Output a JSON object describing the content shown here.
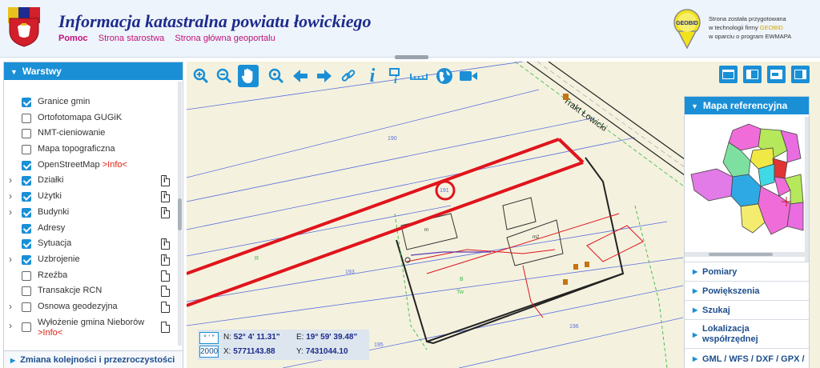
{
  "header": {
    "title": "Informacja katastralna powiatu łowickiego",
    "links": [
      "Pomoc",
      "Strona starostwa",
      "Strona główna geoportalu"
    ],
    "geobid_lines": [
      "Strona została przygotowana",
      "w technologii firmy ",
      "w oparciu o program EWMAPA"
    ],
    "geobid_brand": "GEOBID",
    "geobid_logo_text": "GEOBID"
  },
  "layers_panel": {
    "title": "Warstwy",
    "items": [
      {
        "label": "Granice gmin",
        "checked": true,
        "expandable": false,
        "icon": "none"
      },
      {
        "label": "Ortofotomapa GUGiK",
        "checked": false,
        "expandable": false,
        "icon": "none"
      },
      {
        "label": "NMT-cieniowanie",
        "checked": false,
        "expandable": false,
        "icon": "none"
      },
      {
        "label": "Mapa topograficzna",
        "checked": false,
        "expandable": false,
        "icon": "none"
      },
      {
        "label": "OpenStreetMap ",
        "info": ">Info<",
        "checked": true,
        "expandable": false,
        "icon": "none"
      },
      {
        "label": "Działki",
        "checked": true,
        "expandable": true,
        "icon": "info-doc"
      },
      {
        "label": "Użytki",
        "checked": true,
        "expandable": true,
        "icon": "info-doc"
      },
      {
        "label": "Budynki",
        "checked": true,
        "expandable": true,
        "icon": "info-doc"
      },
      {
        "label": "Adresy",
        "checked": true,
        "expandable": false,
        "icon": "none"
      },
      {
        "label": "Sytuacja",
        "checked": true,
        "expandable": false,
        "icon": "info-doc"
      },
      {
        "label": "Uzbrojenie",
        "checked": true,
        "expandable": true,
        "icon": "info-doc"
      },
      {
        "label": "Rzeźba",
        "checked": false,
        "expandable": false,
        "icon": "doc"
      },
      {
        "label": "Transakcje RCN",
        "checked": false,
        "expandable": false,
        "icon": "doc"
      },
      {
        "label": "Osnowa geodezyjna",
        "checked": false,
        "expandable": true,
        "icon": "doc"
      },
      {
        "label": "Wyłożenie gmina Nieborów",
        "info": ">Info<",
        "checked": false,
        "expandable": true,
        "icon": "doc",
        "tall": true
      }
    ],
    "footer": "Zmiana kolejności i przezroczystości"
  },
  "toolbar": {
    "tools": [
      "zoom-in-icon",
      "zoom-out-icon",
      "pan-hand-icon",
      "zoom-box-icon",
      "back-arrow-icon",
      "forward-arrow-icon",
      "link-icon",
      "info-icon",
      "query-icon",
      "measure-icon",
      "globe-icon",
      "camera-icon"
    ],
    "active": "pan-hand-icon",
    "layout_tools": [
      "layout-full-icon",
      "layout-left-icon",
      "layout-right-arrow-icon",
      "layout-right-panel-icon"
    ]
  },
  "map": {
    "street_label": "Trakt Łowicki",
    "parcel_labels": [
      "190",
      "191",
      "193",
      "195",
      "196"
    ],
    "use_labels": [
      "R",
      "B",
      "Tw"
    ],
    "building_labels": [
      "m",
      "m2"
    ],
    "accent_color": "#1a8fd6",
    "highlight_color": "#e0141c"
  },
  "reference_panel": {
    "title": "Mapa referencyjna",
    "sections": [
      "Pomiary",
      "Powiększenia",
      "Szukaj",
      "Lokalizacja współrzędnej",
      "GML / WFS / DXF / GPX /"
    ]
  },
  "coords": {
    "format_dms": "° ' \"",
    "format_crs": "2000",
    "n_label": "N:",
    "n_value": "52° 4' 11.31\"",
    "e_label": "E:",
    "e_value": "19° 59' 39.48\"",
    "x_label": "X:",
    "x_value": "5771143.88",
    "y_label": "Y:",
    "y_value": "7431044.10"
  }
}
